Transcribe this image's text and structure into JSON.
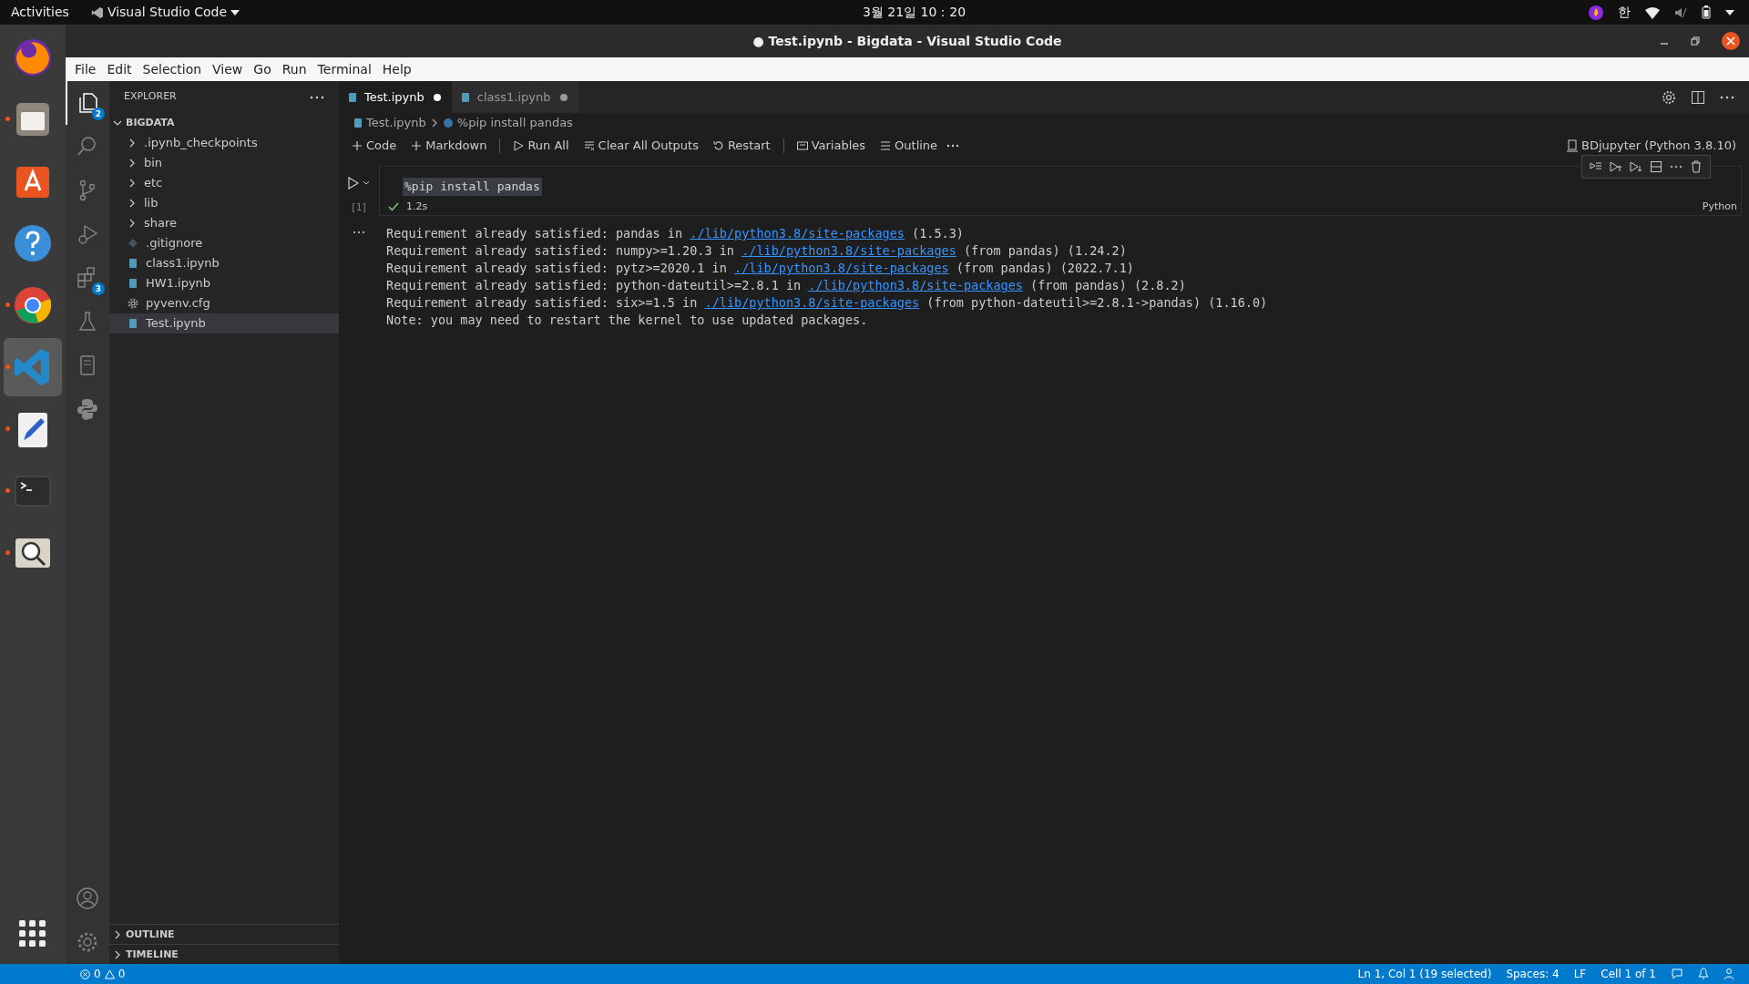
{
  "topbar": {
    "activities": "Activities",
    "app_name": "Visual Studio Code",
    "clock": "3월 21일  10：20",
    "input_method": "한"
  },
  "dock": [
    {
      "kind": "firefox",
      "running": false,
      "selected": false
    },
    {
      "kind": "files",
      "running": true,
      "selected": false
    },
    {
      "kind": "store",
      "running": false,
      "selected": false
    },
    {
      "kind": "help",
      "running": false,
      "selected": false
    },
    {
      "kind": "chrome",
      "running": true,
      "selected": false
    },
    {
      "kind": "vscode",
      "running": true,
      "selected": true
    },
    {
      "kind": "editor",
      "running": true,
      "selected": false
    },
    {
      "kind": "terminal",
      "running": true,
      "selected": false
    },
    {
      "kind": "search",
      "running": true,
      "selected": false
    }
  ],
  "window": {
    "title": "● Test.ipynb - Bigdata - Visual Studio Code"
  },
  "menu": [
    "File",
    "Edit",
    "Selection",
    "View",
    "Go",
    "Run",
    "Terminal",
    "Help"
  ],
  "activity_bar": [
    {
      "kind": "explorer",
      "badge": "2",
      "selected": true
    },
    {
      "kind": "search",
      "selected": false
    },
    {
      "kind": "scm",
      "selected": false
    },
    {
      "kind": "debug",
      "selected": false
    },
    {
      "kind": "extensions",
      "badge": "3",
      "selected": false
    },
    {
      "kind": "testing",
      "selected": false
    },
    {
      "kind": "notebook",
      "selected": false
    },
    {
      "kind": "python",
      "selected": false
    }
  ],
  "sidebar": {
    "title": "EXPLORER",
    "root": {
      "label": "BIGDATA",
      "expanded": true,
      "children": [
        {
          "label": ".ipynb_checkpoints",
          "kind": "folder",
          "expanded": false,
          "selected": false
        },
        {
          "label": "bin",
          "kind": "folder",
          "expanded": false,
          "selected": false
        },
        {
          "label": "etc",
          "kind": "folder",
          "expanded": false,
          "selected": false
        },
        {
          "label": "lib",
          "kind": "folder",
          "expanded": false,
          "selected": false
        },
        {
          "label": "share",
          "kind": "folder",
          "expanded": false,
          "selected": false
        },
        {
          "label": ".gitignore",
          "kind": "git",
          "selected": false
        },
        {
          "label": "class1.ipynb",
          "kind": "notebook",
          "selected": false
        },
        {
          "label": "HW1.ipynb",
          "kind": "notebook",
          "selected": false
        },
        {
          "label": "pyvenv.cfg",
          "kind": "config",
          "selected": false
        },
        {
          "label": "Test.ipynb",
          "kind": "notebook",
          "selected": true
        }
      ]
    },
    "panels": [
      {
        "label": "OUTLINE",
        "expanded": false
      },
      {
        "label": "TIMELINE",
        "expanded": false
      }
    ]
  },
  "tabs": [
    {
      "label": "Test.ipynb",
      "selected": true,
      "dirty": true
    },
    {
      "label": "class1.ipynb",
      "selected": false,
      "dirty": true
    }
  ],
  "breadcrumbs": [
    "Test.ipynb",
    "%pip install pandas"
  ],
  "toolbar": [
    {
      "kind": "add",
      "label": "Code"
    },
    {
      "kind": "add",
      "label": "Markdown"
    },
    {
      "kind": "run",
      "label": "Run All"
    },
    {
      "kind": "clear",
      "label": "Clear All Outputs"
    },
    {
      "kind": "restart",
      "label": "Restart"
    },
    {
      "kind": "variables",
      "label": "Variables"
    },
    {
      "kind": "outline",
      "label": "Outline"
    }
  ],
  "kernel": "BDjupyter (Python 3.8.10)",
  "cell": {
    "execution_count": "[1]",
    "code": "%pip install pandas",
    "succeeded": true,
    "duration": "1.2s",
    "language": "Python",
    "output": [
      [
        {
          "text": "Requirement already satisfied: pandas in "
        },
        {
          "text": "./lib/python3.8/site-packages",
          "link": true
        },
        {
          "text": " (1.5.3)"
        }
      ],
      [
        {
          "text": "Requirement already satisfied: numpy>=1.20.3 in "
        },
        {
          "text": "./lib/python3.8/site-packages",
          "link": true
        },
        {
          "text": " (from pandas) (1.24.2)"
        }
      ],
      [
        {
          "text": "Requirement already satisfied: pytz>=2020.1 in "
        },
        {
          "text": "./lib/python3.8/site-packages",
          "link": true
        },
        {
          "text": " (from pandas) (2022.7.1)"
        }
      ],
      [
        {
          "text": "Requirement already satisfied: python-dateutil>=2.8.1 in "
        },
        {
          "text": "./lib/python3.8/site-packages",
          "link": true
        },
        {
          "text": " (from pandas) (2.8.2)"
        }
      ],
      [
        {
          "text": "Requirement already satisfied: six>=1.5 in "
        },
        {
          "text": "./lib/python3.8/site-packages",
          "link": true
        },
        {
          "text": " (from python-dateutil>=2.8.1->pandas) (1.16.0)"
        }
      ],
      [
        {
          "text": "Note: you may need to restart the kernel to use updated packages."
        }
      ]
    ]
  },
  "status_bar": {
    "errors": "0",
    "warnings": "0",
    "right": [
      "Ln 1, Col 1 (19 selected)",
      "Spaces: 4",
      "LF",
      "Cell 1 of 1"
    ]
  }
}
